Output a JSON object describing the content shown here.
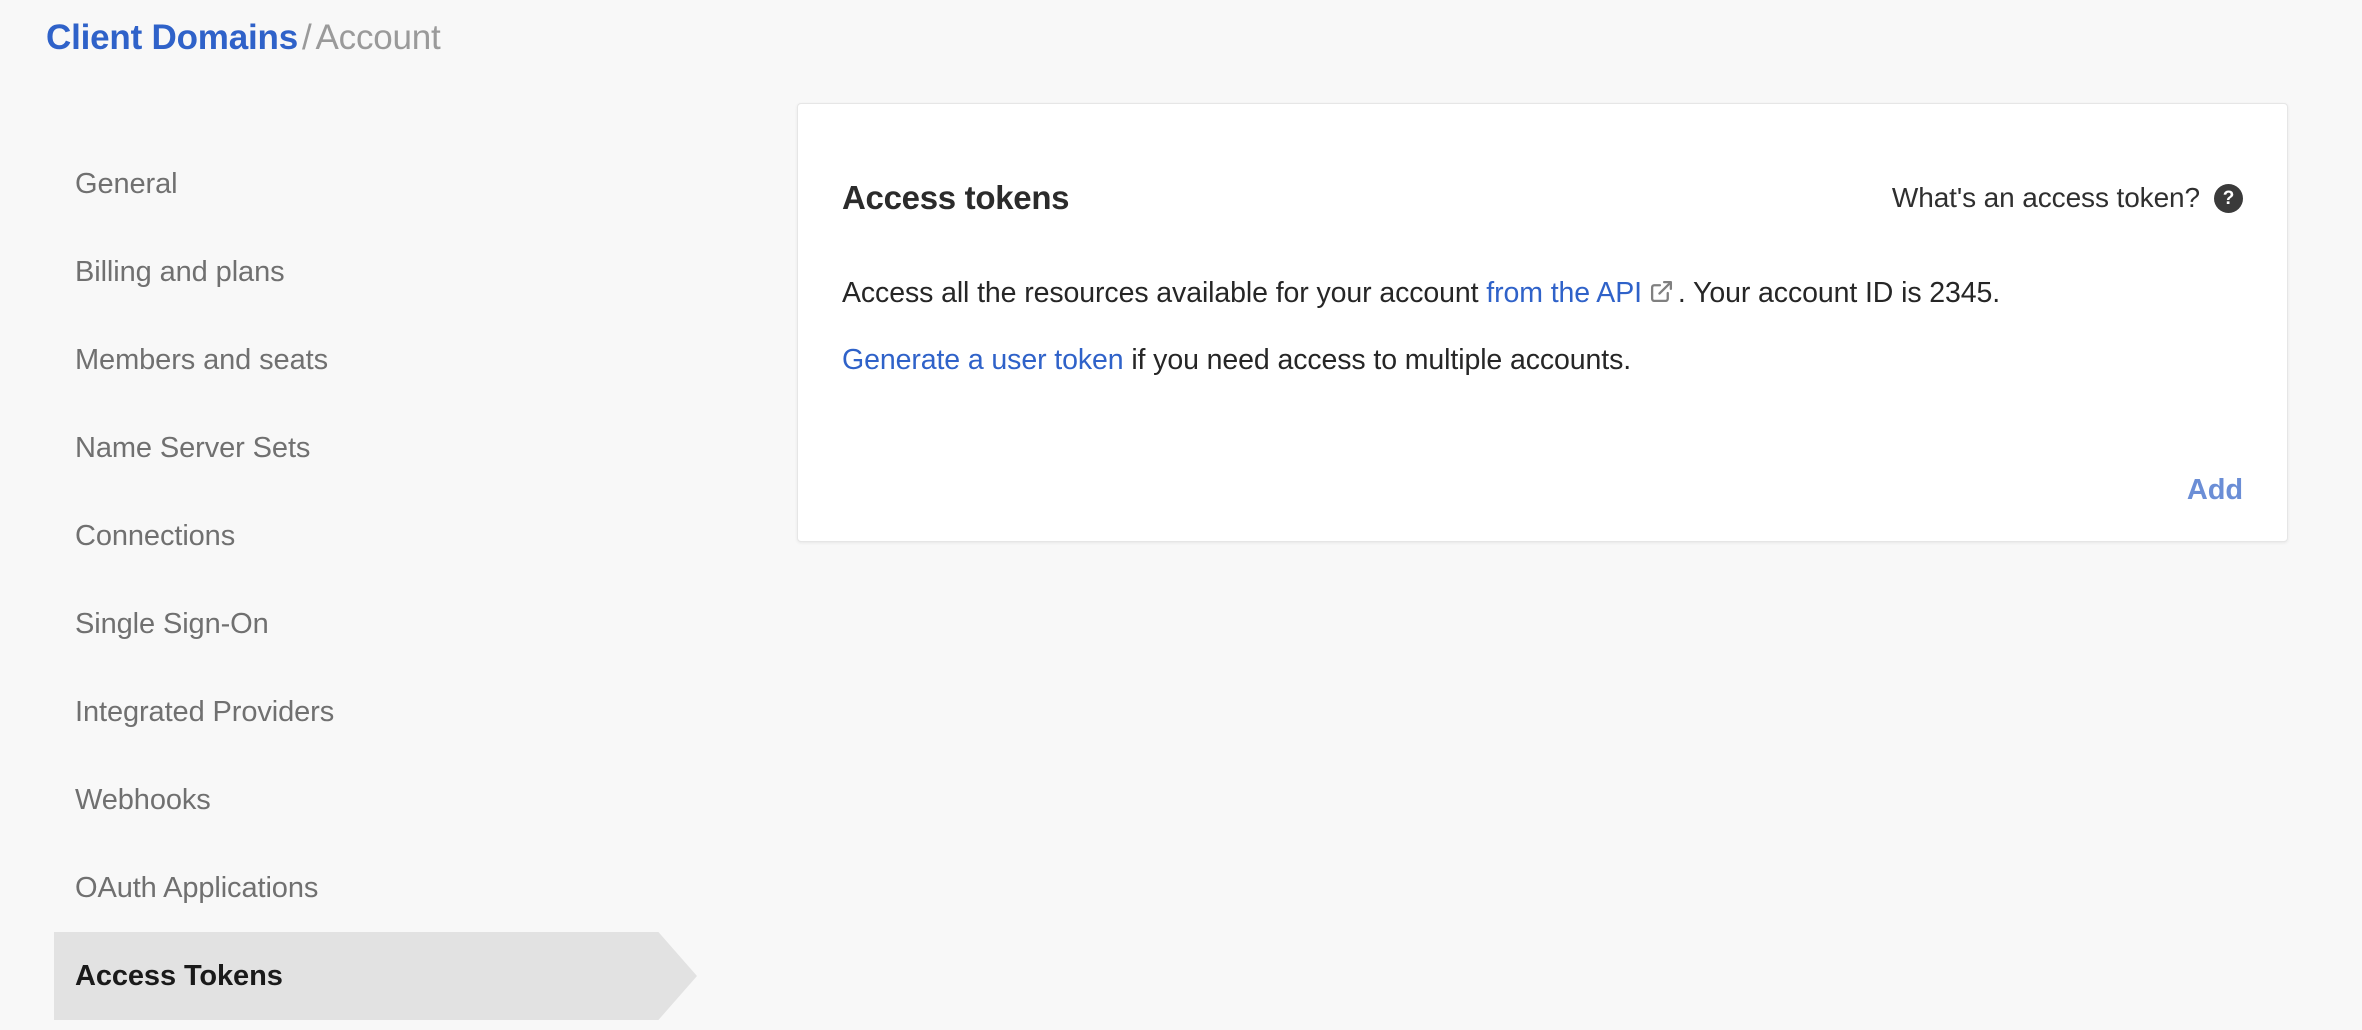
{
  "breadcrumb": {
    "root": "Client Domains",
    "separator": "/",
    "current": "Account"
  },
  "sidebar": {
    "items": [
      {
        "label": "General",
        "active": false
      },
      {
        "label": "Billing and plans",
        "active": false
      },
      {
        "label": "Members and seats",
        "active": false
      },
      {
        "label": "Name Server Sets",
        "active": false
      },
      {
        "label": "Connections",
        "active": false
      },
      {
        "label": "Single Sign-On",
        "active": false
      },
      {
        "label": "Integrated Providers",
        "active": false
      },
      {
        "label": "Webhooks",
        "active": false
      },
      {
        "label": "OAuth Applications",
        "active": false
      },
      {
        "label": "Access Tokens",
        "active": true
      }
    ]
  },
  "card": {
    "title": "Access tokens",
    "help": {
      "text": "What's an access token?",
      "badge": "?",
      "icon": "question-mark-circle-icon"
    },
    "paragraph1": {
      "before_link": "Access all the resources available for your account ",
      "link": "from the API",
      "link_icon": "external-link-icon",
      "after_link": ". Your account ID is 2345."
    },
    "paragraph2": {
      "link": "Generate a user token",
      "after_link": " if you need access to multiple accounts."
    },
    "add_label": "Add"
  },
  "colors": {
    "page_background": "#f8f8f8",
    "card_background": "#ffffff",
    "link_blue": "#2f62c9",
    "add_blue": "#6b8ed6",
    "active_nav_background": "#e2e2e2",
    "muted_text": "#707070",
    "help_badge_background": "#3a3a3a"
  }
}
